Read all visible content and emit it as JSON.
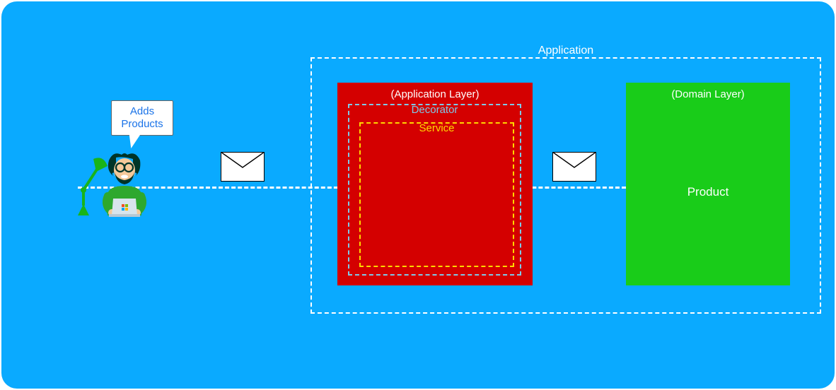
{
  "speech": "Adds Products",
  "application": {
    "label": "Application",
    "appLayer": {
      "label": "(Application Layer)",
      "decorator": "Decorator",
      "service": "Service"
    },
    "domainLayer": {
      "label": "(Domain Layer)",
      "entity": "Product"
    }
  }
}
